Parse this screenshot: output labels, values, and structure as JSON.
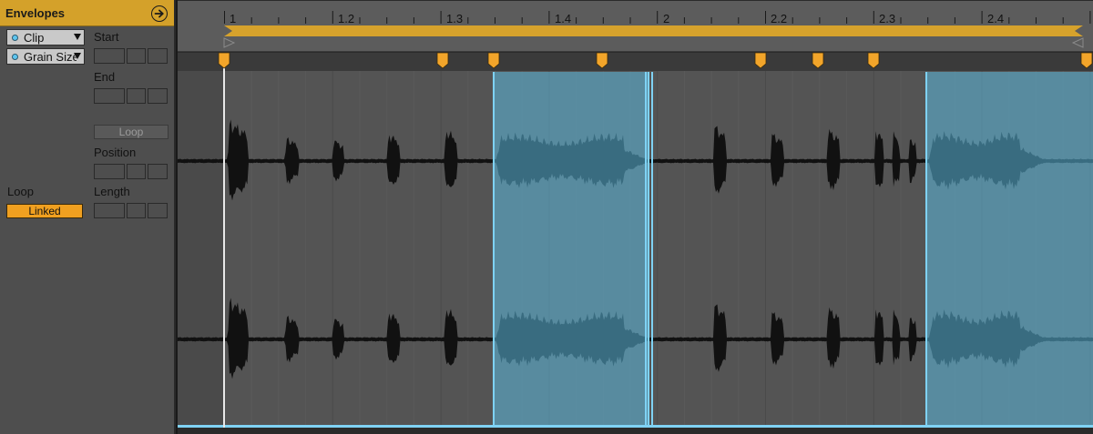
{
  "panel": {
    "title": "Envelopes",
    "header_icon": "arrow-right-circle-icon",
    "device_chooser": {
      "value": "Clip"
    },
    "control_chooser": {
      "value": "Grain Size"
    },
    "start_label": "Start",
    "end_label": "End",
    "loop_button": "Loop",
    "position_label": "Position",
    "length_label": "Length",
    "loop_section_label": "Loop",
    "linked_button": "Linked"
  },
  "ruler": {
    "bar_labels": [
      "1",
      "1.2",
      "1.3",
      "1.4",
      "2",
      "2.2",
      "2.3",
      "2.4"
    ]
  },
  "colors": {
    "accent": "#d4a12a",
    "loop_bar": "#d6a22c",
    "marker": "#f2a52a",
    "selection": "#5bb8dc",
    "waveform": "#111111",
    "clip_bg": "#545454"
  },
  "icons": [
    "arrow-right-circle-icon",
    "chevron-down-icon",
    "warp-marker-icon",
    "loop-brace-icon"
  ]
}
